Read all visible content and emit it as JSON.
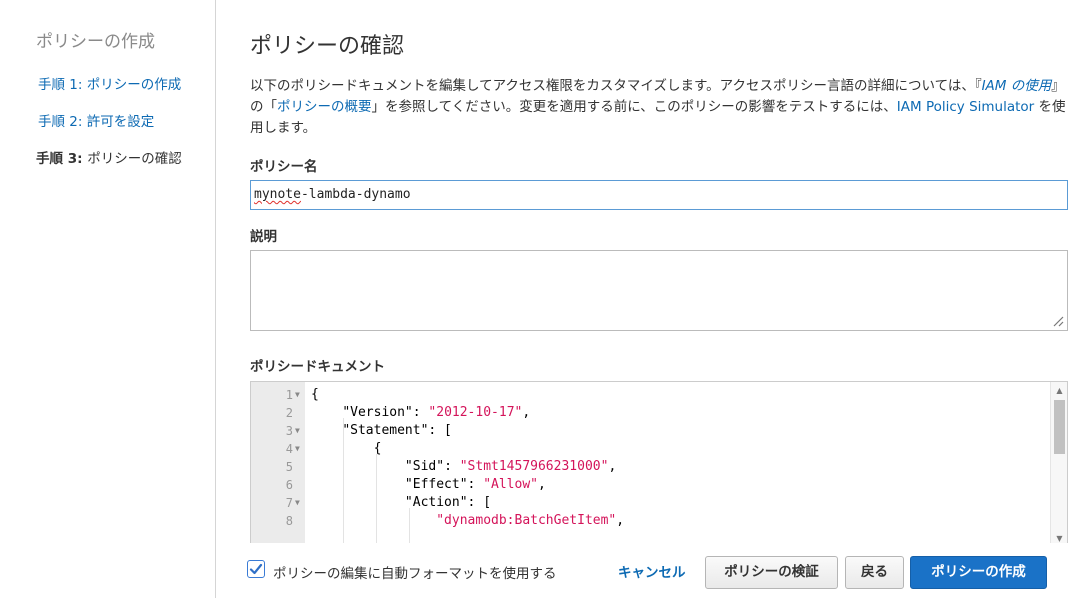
{
  "sidebar": {
    "title": "ポリシーの作成",
    "steps": [
      {
        "prefix": "手順 1: ",
        "label": "ポリシーの作成"
      },
      {
        "prefix": "手順 2: ",
        "label": "許可を設定"
      },
      {
        "prefix": "手順 3: ",
        "label": "ポリシーの確認"
      }
    ]
  },
  "main": {
    "title": "ポリシーの確認",
    "description": {
      "part1": "以下のポリシードキュメントを編集してアクセス権限をカスタマイズします。アクセスポリシー言語の詳細については、『",
      "guide_link": "IAM の使用",
      "part2": "』の「",
      "overview_link": "ポリシーの概要",
      "part3": "」を参照してください。変更を適用する前に、このポリシーの影響をテストするには、",
      "simulator_link": "IAM Policy Simulator",
      "part4": " を使用します。"
    },
    "policy_name_label": "ポリシー名",
    "policy_name_value_underlined": "mynote",
    "policy_name_value_rest": "-lambda-dynamo",
    "description_label": "説明",
    "description_value": "",
    "document_label": "ポリシードキュメント",
    "editor_lines": [
      {
        "n": "1",
        "fold": true,
        "plain": "{",
        "key": "",
        "sep": "",
        "str": "",
        "tail": ""
      },
      {
        "n": "2",
        "fold": false,
        "plain": "    ",
        "key": "\"Version\"",
        "sep": ": ",
        "str": "\"2012-10-17\"",
        "tail": ","
      },
      {
        "n": "3",
        "fold": true,
        "plain": "    ",
        "key": "\"Statement\"",
        "sep": ": [",
        "str": "",
        "tail": ""
      },
      {
        "n": "4",
        "fold": true,
        "plain": "        {",
        "key": "",
        "sep": "",
        "str": "",
        "tail": ""
      },
      {
        "n": "5",
        "fold": false,
        "plain": "            ",
        "key": "\"Sid\"",
        "sep": ": ",
        "str": "\"Stmt1457966231000\"",
        "tail": ","
      },
      {
        "n": "6",
        "fold": false,
        "plain": "            ",
        "key": "\"Effect\"",
        "sep": ": ",
        "str": "\"Allow\"",
        "tail": ","
      },
      {
        "n": "7",
        "fold": true,
        "plain": "            ",
        "key": "\"Action\"",
        "sep": ": [",
        "str": "",
        "tail": ""
      },
      {
        "n": "8",
        "fold": false,
        "plain": "                ",
        "key": "",
        "sep": "",
        "str": "\"dynamodb:BatchGetItem\"",
        "tail": ","
      }
    ],
    "autoformat_label": "ポリシーの編集に自動フォーマットを使用する",
    "autoformat_checked": true,
    "cancel_label": "キャンセル",
    "validate_label": "ポリシーの検証",
    "back_label": "戻る",
    "create_label": "ポリシーの作成"
  },
  "colors": {
    "link": "#0d6ab3",
    "primary_button": "#1a72c7",
    "json_string": "#d4145a"
  }
}
